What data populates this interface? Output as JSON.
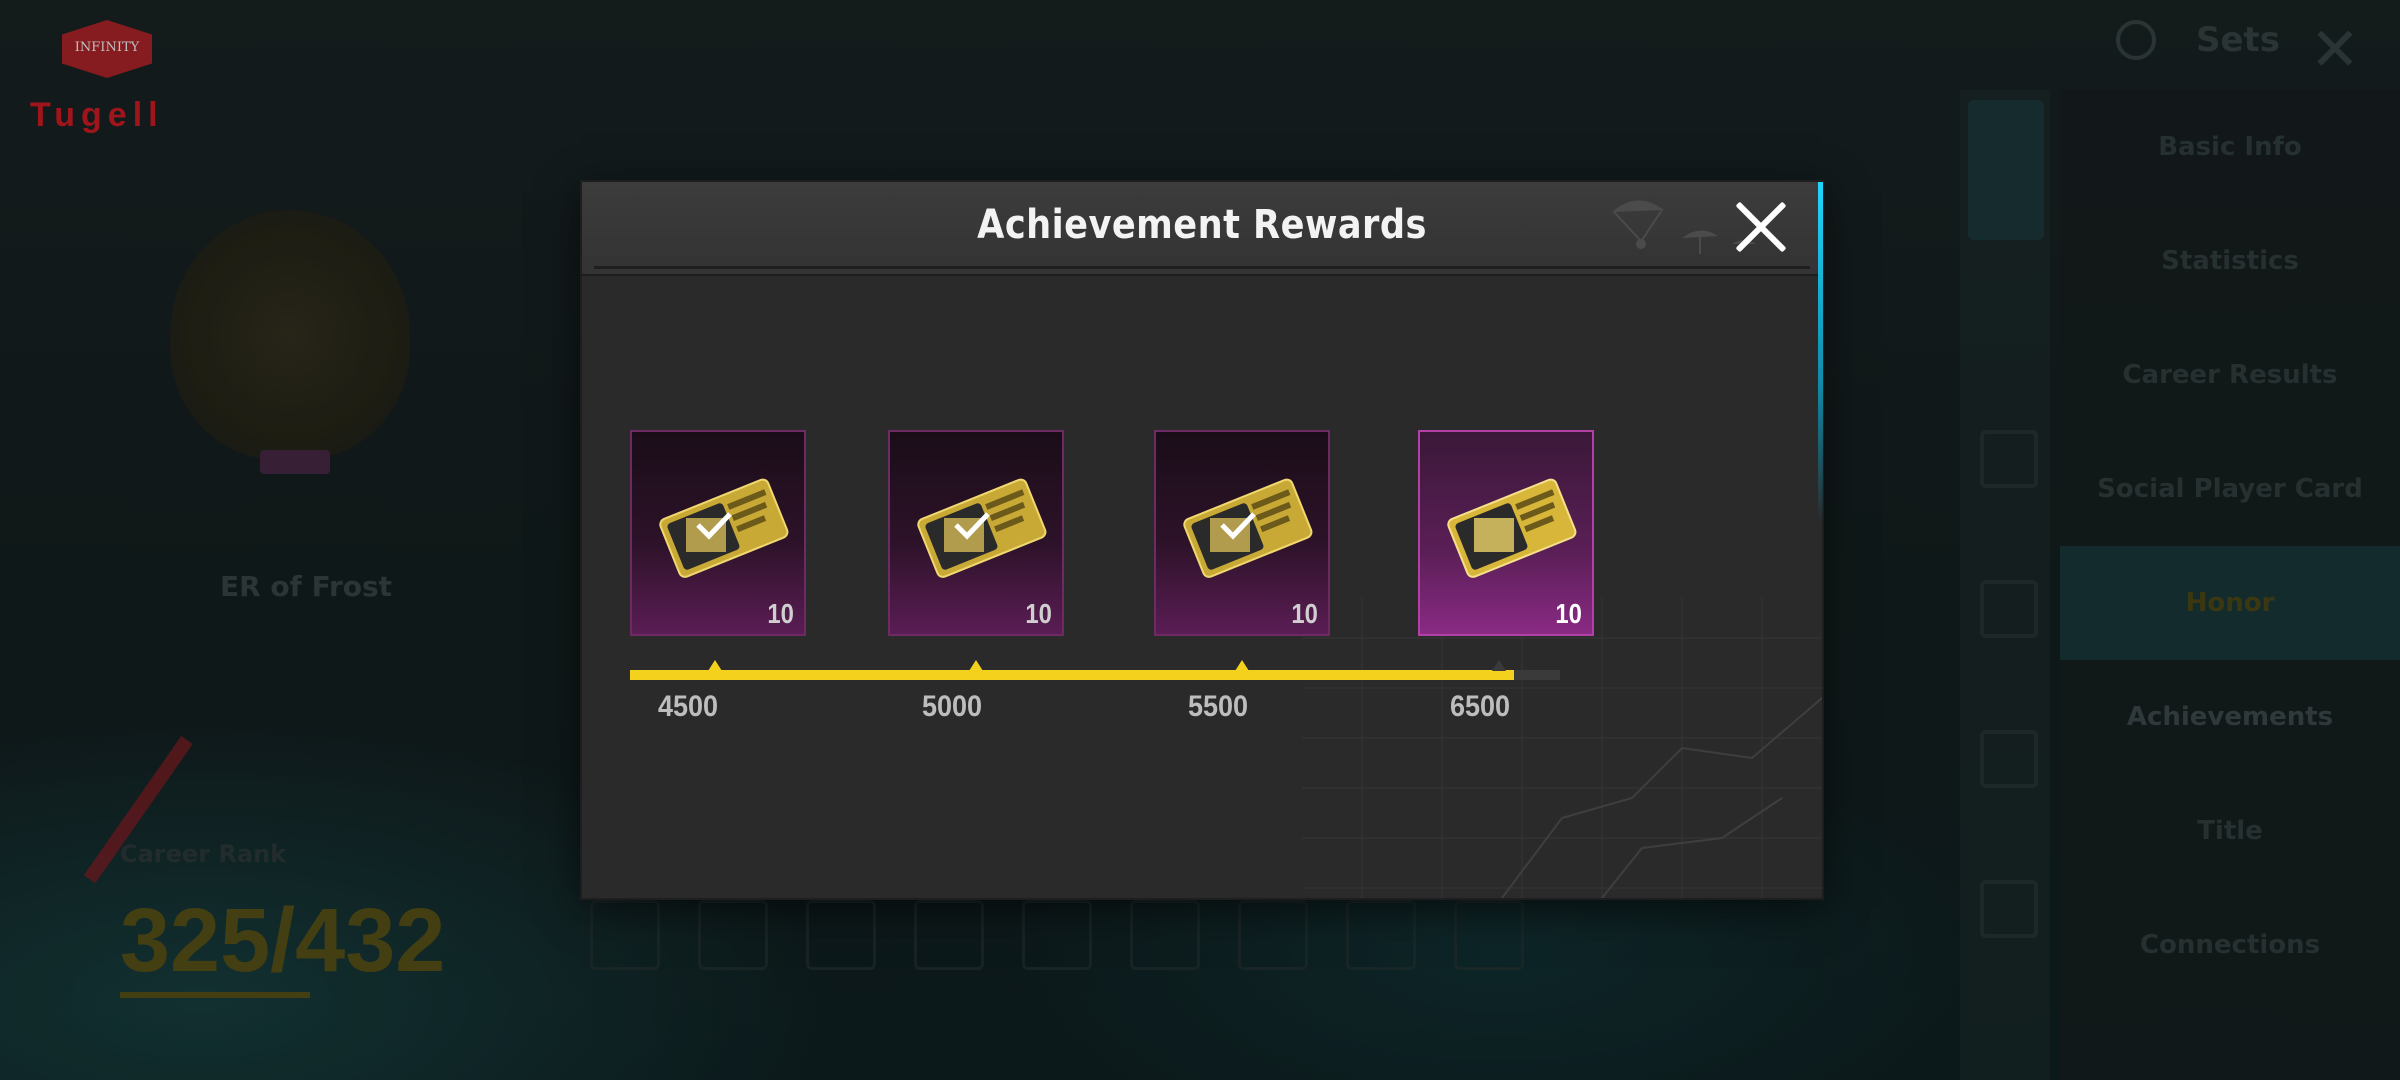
{
  "background": {
    "logo_text": "INFINITY",
    "logo_word": "Tugell",
    "settings_label": "Sets",
    "tier_label": "ER of Frost",
    "season_label": "Career Rank",
    "score": "325/432",
    "right_menu": [
      "Basic Info",
      "Statistics",
      "Career Results",
      "Social Player Card",
      "Honor",
      "Achievements",
      "Title",
      "Connections"
    ]
  },
  "modal": {
    "title": "Achievement Rewards",
    "rewards": [
      {
        "quantity": "10",
        "threshold": "4500",
        "claimed": true
      },
      {
        "quantity": "10",
        "threshold": "5000",
        "claimed": true
      },
      {
        "quantity": "10",
        "threshold": "5500",
        "claimed": true
      },
      {
        "quantity": "10",
        "threshold": "6500",
        "claimed": false
      }
    ],
    "progress_fraction": 0.95
  },
  "colors": {
    "accent_yellow": "#f4d11d",
    "card_border": "#6e2a63",
    "card_border_active": "#b240a6",
    "modal_bg": "#2a2a2a",
    "edge_cyan": "#22d6ff"
  },
  "icons": [
    "close-icon",
    "ticket-icon",
    "check-icon",
    "parachute-icon",
    "gear-icon"
  ]
}
